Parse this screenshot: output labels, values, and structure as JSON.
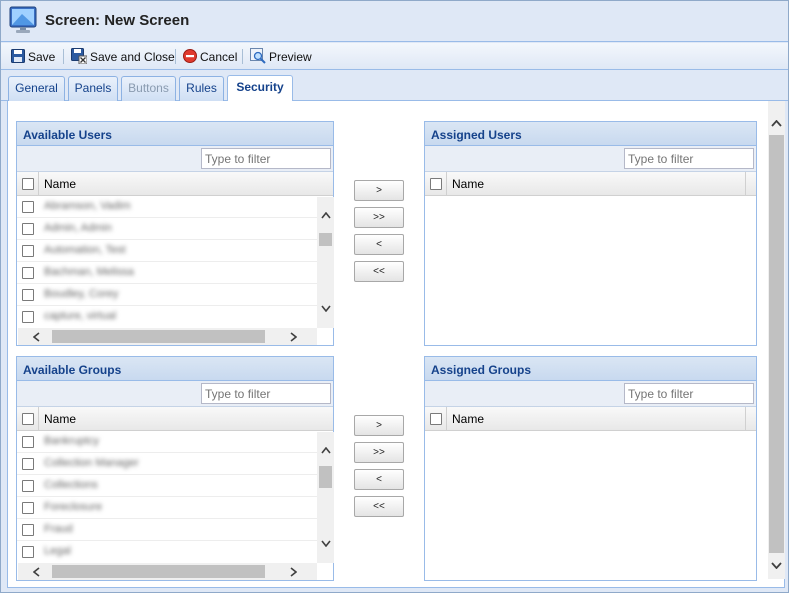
{
  "window": {
    "title": "Screen: New Screen"
  },
  "toolbar": {
    "save": "Save",
    "save_close": "Save and Close",
    "cancel": "Cancel",
    "preview": "Preview"
  },
  "tabs": [
    {
      "label": "General"
    },
    {
      "label": "Panels"
    },
    {
      "label": "Buttons"
    },
    {
      "label": "Rules"
    },
    {
      "label": "Security"
    }
  ],
  "available_users": {
    "title": "Available Users",
    "filter_placeholder": "Type to filter",
    "column": "Name",
    "rows": [
      "Abramson, Vadim",
      "Admin, Admin",
      "Automation, Test",
      "Bachman, Melissa",
      "Boudley, Corey",
      "capture, virtual"
    ]
  },
  "assigned_users": {
    "title": "Assigned Users",
    "filter_placeholder": "Type to filter",
    "column": "Name"
  },
  "available_groups": {
    "title": "Available Groups",
    "filter_placeholder": "Type to filter",
    "column": "Name",
    "rows": [
      "Bankruptcy",
      "Collection Manager",
      "Collections",
      "Foreclosure",
      "Fraud",
      "Legal"
    ]
  },
  "assigned_groups": {
    "title": "Assigned Groups",
    "filter_placeholder": "Type to filter",
    "column": "Name"
  },
  "move_buttons": {
    "add": ">",
    "add_all": ">>",
    "remove": "<",
    "remove_all": "<<"
  }
}
